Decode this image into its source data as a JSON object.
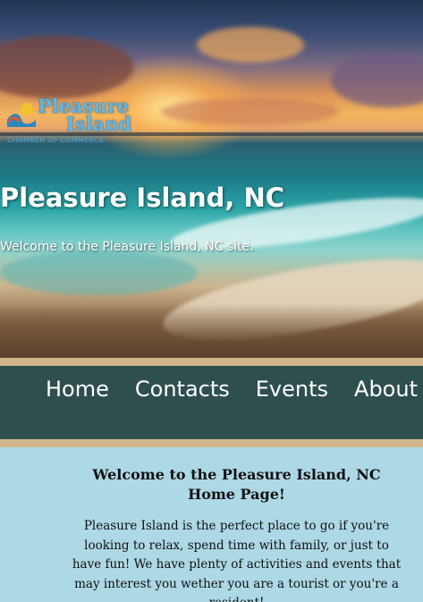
{
  "hero": {
    "logo": {
      "line1": "Pleasure",
      "line2": "Island",
      "tagline": "CHAMBER OF COMMERCE"
    },
    "title": "Pleasure Island, NC",
    "subtitle": "Welcome to the Pleasure Island, NC site."
  },
  "nav": {
    "items": [
      {
        "label": "Home"
      },
      {
        "label": "Contacts"
      },
      {
        "label": "Events"
      },
      {
        "label": "About"
      }
    ]
  },
  "main": {
    "heading": "Welcome to the Pleasure Island, NC Home Page!",
    "paragraph": "Pleasure Island is the perfect place to go if you're looking to relax, spend time with family, or just to have fun! We have plenty of activities and events that may interest you wether you are a tourist or you're a resident!"
  },
  "colors": {
    "nav_background": "#2f4f4f",
    "nav_border": "#d2b48c",
    "page_background": "#add8e6",
    "logo_blue": "#5fb6e6"
  }
}
